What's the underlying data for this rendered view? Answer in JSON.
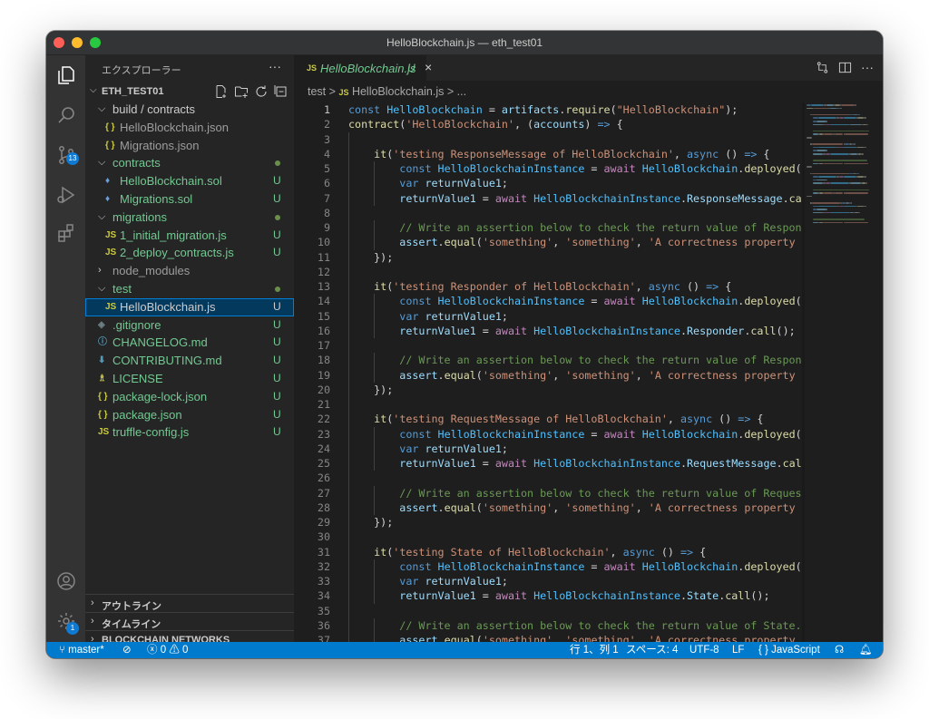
{
  "window": {
    "title": "HelloBlockchain.js — eth_test01"
  },
  "activity": {
    "scm_badge": "13",
    "manage_badge": "1"
  },
  "sidebar": {
    "header": "エクスプローラー",
    "more": "···",
    "workspace": "ETH_TEST01",
    "tree": [
      {
        "label": "build / contracts",
        "icon": "",
        "status": "",
        "level": 1,
        "type": "folder",
        "color": "white"
      },
      {
        "label": "HelloBlockchain.json",
        "icon": "{ }",
        "status": "",
        "level": 2,
        "type": "json",
        "color": "grey"
      },
      {
        "label": "Migrations.json",
        "icon": "{ }",
        "status": "",
        "level": 2,
        "type": "json",
        "color": "grey"
      },
      {
        "label": "contracts",
        "icon": "",
        "status": "",
        "level": 1,
        "type": "folder",
        "color": "green",
        "dot": true
      },
      {
        "label": "HelloBlockchain.sol",
        "icon": "♦",
        "status": "U",
        "level": 2,
        "type": "sol",
        "color": "green"
      },
      {
        "label": "Migrations.sol",
        "icon": "♦",
        "status": "U",
        "level": 2,
        "type": "sol",
        "color": "green"
      },
      {
        "label": "migrations",
        "icon": "",
        "status": "",
        "level": 1,
        "type": "folder",
        "color": "green",
        "dot": true
      },
      {
        "label": "1_initial_migration.js",
        "icon": "JS",
        "status": "U",
        "level": 2,
        "type": "js",
        "color": "green"
      },
      {
        "label": "2_deploy_contracts.js",
        "icon": "JS",
        "status": "U",
        "level": 2,
        "type": "js",
        "color": "green"
      },
      {
        "label": "node_modules",
        "icon": "",
        "status": "",
        "level": 1,
        "type": "folder-closed",
        "color": "grey"
      },
      {
        "label": "test",
        "icon": "",
        "status": "",
        "level": 1,
        "type": "folder",
        "color": "green",
        "dot": true
      },
      {
        "label": "HelloBlockchain.js",
        "icon": "JS",
        "status": "U",
        "level": 2,
        "type": "js",
        "color": "white",
        "selected": true
      },
      {
        "label": ".gitignore",
        "icon": "◈",
        "status": "U",
        "level": 1,
        "type": "git",
        "color": "green"
      },
      {
        "label": "CHANGELOG.md",
        "icon": "ⓘ",
        "status": "U",
        "level": 1,
        "type": "md",
        "color": "green"
      },
      {
        "label": "CONTRIBUTING.md",
        "icon": "⬇",
        "status": "U",
        "level": 1,
        "type": "md",
        "color": "green"
      },
      {
        "label": "LICENSE",
        "icon": "♗",
        "status": "U",
        "level": 1,
        "type": "license",
        "color": "green"
      },
      {
        "label": "package-lock.json",
        "icon": "{ }",
        "status": "U",
        "level": 1,
        "type": "json",
        "color": "green"
      },
      {
        "label": "package.json",
        "icon": "{ }",
        "status": "U",
        "level": 1,
        "type": "json",
        "color": "green"
      },
      {
        "label": "truffle-config.js",
        "icon": "JS",
        "status": "U",
        "level": 1,
        "type": "js",
        "color": "green"
      }
    ],
    "bottom": [
      "アウトライン",
      "タイムライン",
      "BLOCKCHAIN NETWORKS"
    ]
  },
  "editor": {
    "tab": {
      "icon": "JS",
      "name": "HelloBlockchain.js",
      "status": "U",
      "close": "×"
    },
    "breadcrumb": {
      "folder": "test",
      "sep": ">",
      "icon": "JS",
      "file": "HelloBlockchain.js",
      "tail": "> ..."
    },
    "lines": [
      [
        [
          "k",
          "const "
        ],
        [
          "cc",
          "HelloBlockchain"
        ],
        [
          "p",
          " = "
        ],
        [
          "v",
          "artifacts"
        ],
        [
          "p",
          "."
        ],
        [
          "f",
          "require"
        ],
        [
          "p",
          "("
        ],
        [
          "s",
          "\"HelloBlockchain\""
        ],
        [
          "p",
          ");"
        ]
      ],
      [
        [
          "f",
          "contract"
        ],
        [
          "p",
          "("
        ],
        [
          "s",
          "'HelloBlockchain'"
        ],
        [
          "p",
          ", ("
        ],
        [
          "v",
          "accounts"
        ],
        [
          "p",
          ") "
        ],
        [
          "k",
          "=>"
        ],
        [
          "p",
          " {"
        ]
      ],
      [],
      [
        [
          "p",
          "    "
        ],
        [
          "f",
          "it"
        ],
        [
          "p",
          "("
        ],
        [
          "s",
          "'testing ResponseMessage of HelloBlockchain'"
        ],
        [
          "p",
          ", "
        ],
        [
          "k",
          "async"
        ],
        [
          "p",
          " () "
        ],
        [
          "k",
          "=>"
        ],
        [
          "p",
          " {"
        ]
      ],
      [
        [
          "p",
          "        "
        ],
        [
          "k",
          "const "
        ],
        [
          "cc",
          "HelloBlockchainInstance"
        ],
        [
          "p",
          " = "
        ],
        [
          "kw",
          "await "
        ],
        [
          "cc",
          "HelloBlockchain"
        ],
        [
          "p",
          "."
        ],
        [
          "f",
          "deployed"
        ],
        [
          "p",
          "();"
        ]
      ],
      [
        [
          "p",
          "        "
        ],
        [
          "k",
          "var "
        ],
        [
          "v",
          "returnValue1"
        ],
        [
          "p",
          ";"
        ]
      ],
      [
        [
          "p",
          "        "
        ],
        [
          "v",
          "returnValue1"
        ],
        [
          "p",
          " = "
        ],
        [
          "kw",
          "await "
        ],
        [
          "cc",
          "HelloBlockchainInstance"
        ],
        [
          "p",
          "."
        ],
        [
          "v",
          "ResponseMessage"
        ],
        [
          "p",
          "."
        ],
        [
          "f",
          "call"
        ],
        [
          "p",
          "();"
        ]
      ],
      [],
      [
        [
          "p",
          "        "
        ],
        [
          "c",
          "// Write an assertion below to check the return value of ResponseMess"
        ]
      ],
      [
        [
          "p",
          "        "
        ],
        [
          "v",
          "assert"
        ],
        [
          "p",
          "."
        ],
        [
          "f",
          "equal"
        ],
        [
          "p",
          "("
        ],
        [
          "s",
          "'something'"
        ],
        [
          "p",
          ", "
        ],
        [
          "s",
          "'something'"
        ],
        [
          "p",
          ", "
        ],
        [
          "s",
          "'A correctness property about"
        ]
      ],
      [
        [
          "p",
          "    });"
        ]
      ],
      [],
      [
        [
          "p",
          "    "
        ],
        [
          "f",
          "it"
        ],
        [
          "p",
          "("
        ],
        [
          "s",
          "'testing Responder of HelloBlockchain'"
        ],
        [
          "p",
          ", "
        ],
        [
          "k",
          "async"
        ],
        [
          "p",
          " () "
        ],
        [
          "k",
          "=>"
        ],
        [
          "p",
          " {"
        ]
      ],
      [
        [
          "p",
          "        "
        ],
        [
          "k",
          "const "
        ],
        [
          "cc",
          "HelloBlockchainInstance"
        ],
        [
          "p",
          " = "
        ],
        [
          "kw",
          "await "
        ],
        [
          "cc",
          "HelloBlockchain"
        ],
        [
          "p",
          "."
        ],
        [
          "f",
          "deployed"
        ],
        [
          "p",
          "();"
        ]
      ],
      [
        [
          "p",
          "        "
        ],
        [
          "k",
          "var "
        ],
        [
          "v",
          "returnValue1"
        ],
        [
          "p",
          ";"
        ]
      ],
      [
        [
          "p",
          "        "
        ],
        [
          "v",
          "returnValue1"
        ],
        [
          "p",
          " = "
        ],
        [
          "kw",
          "await "
        ],
        [
          "cc",
          "HelloBlockchainInstance"
        ],
        [
          "p",
          "."
        ],
        [
          "v",
          "Responder"
        ],
        [
          "p",
          "."
        ],
        [
          "f",
          "call"
        ],
        [
          "p",
          "();"
        ]
      ],
      [],
      [
        [
          "p",
          "        "
        ],
        [
          "c",
          "// Write an assertion below to check the return value of Responder."
        ]
      ],
      [
        [
          "p",
          "        "
        ],
        [
          "v",
          "assert"
        ],
        [
          "p",
          "."
        ],
        [
          "f",
          "equal"
        ],
        [
          "p",
          "("
        ],
        [
          "s",
          "'something'"
        ],
        [
          "p",
          ", "
        ],
        [
          "s",
          "'something'"
        ],
        [
          "p",
          ", "
        ],
        [
          "s",
          "'A correctness property about"
        ]
      ],
      [
        [
          "p",
          "    });"
        ]
      ],
      [],
      [
        [
          "p",
          "    "
        ],
        [
          "f",
          "it"
        ],
        [
          "p",
          "("
        ],
        [
          "s",
          "'testing RequestMessage of HelloBlockchain'"
        ],
        [
          "p",
          ", "
        ],
        [
          "k",
          "async"
        ],
        [
          "p",
          " () "
        ],
        [
          "k",
          "=>"
        ],
        [
          "p",
          " {"
        ]
      ],
      [
        [
          "p",
          "        "
        ],
        [
          "k",
          "const "
        ],
        [
          "cc",
          "HelloBlockchainInstance"
        ],
        [
          "p",
          " = "
        ],
        [
          "kw",
          "await "
        ],
        [
          "cc",
          "HelloBlockchain"
        ],
        [
          "p",
          "."
        ],
        [
          "f",
          "deployed"
        ],
        [
          "p",
          "();"
        ]
      ],
      [
        [
          "p",
          "        "
        ],
        [
          "k",
          "var "
        ],
        [
          "v",
          "returnValue1"
        ],
        [
          "p",
          ";"
        ]
      ],
      [
        [
          "p",
          "        "
        ],
        [
          "v",
          "returnValue1"
        ],
        [
          "p",
          " = "
        ],
        [
          "kw",
          "await "
        ],
        [
          "cc",
          "HelloBlockchainInstance"
        ],
        [
          "p",
          "."
        ],
        [
          "v",
          "RequestMessage"
        ],
        [
          "p",
          "."
        ],
        [
          "f",
          "call"
        ],
        [
          "p",
          "();"
        ]
      ],
      [],
      [
        [
          "p",
          "        "
        ],
        [
          "c",
          "// Write an assertion below to check the return value of RequestMessa"
        ]
      ],
      [
        [
          "p",
          "        "
        ],
        [
          "v",
          "assert"
        ],
        [
          "p",
          "."
        ],
        [
          "f",
          "equal"
        ],
        [
          "p",
          "("
        ],
        [
          "s",
          "'something'"
        ],
        [
          "p",
          ", "
        ],
        [
          "s",
          "'something'"
        ],
        [
          "p",
          ", "
        ],
        [
          "s",
          "'A correctness property about"
        ]
      ],
      [
        [
          "p",
          "    });"
        ]
      ],
      [],
      [
        [
          "p",
          "    "
        ],
        [
          "f",
          "it"
        ],
        [
          "p",
          "("
        ],
        [
          "s",
          "'testing State of HelloBlockchain'"
        ],
        [
          "p",
          ", "
        ],
        [
          "k",
          "async"
        ],
        [
          "p",
          " () "
        ],
        [
          "k",
          "=>"
        ],
        [
          "p",
          " {"
        ]
      ],
      [
        [
          "p",
          "        "
        ],
        [
          "k",
          "const "
        ],
        [
          "cc",
          "HelloBlockchainInstance"
        ],
        [
          "p",
          " = "
        ],
        [
          "kw",
          "await "
        ],
        [
          "cc",
          "HelloBlockchain"
        ],
        [
          "p",
          "."
        ],
        [
          "f",
          "deployed"
        ],
        [
          "p",
          "();"
        ]
      ],
      [
        [
          "p",
          "        "
        ],
        [
          "k",
          "var "
        ],
        [
          "v",
          "returnValue1"
        ],
        [
          "p",
          ";"
        ]
      ],
      [
        [
          "p",
          "        "
        ],
        [
          "v",
          "returnValue1"
        ],
        [
          "p",
          " = "
        ],
        [
          "kw",
          "await "
        ],
        [
          "cc",
          "HelloBlockchainInstance"
        ],
        [
          "p",
          "."
        ],
        [
          "v",
          "State"
        ],
        [
          "p",
          "."
        ],
        [
          "f",
          "call"
        ],
        [
          "p",
          "();"
        ]
      ],
      [],
      [
        [
          "p",
          "        "
        ],
        [
          "c",
          "// Write an assertion below to check the return value of State."
        ]
      ],
      [
        [
          "p",
          "        "
        ],
        [
          "v",
          "assert"
        ],
        [
          "p",
          "."
        ],
        [
          "f",
          "equal"
        ],
        [
          "p",
          "("
        ],
        [
          "s",
          "'something'"
        ],
        [
          "p",
          ", "
        ],
        [
          "s",
          "'something'"
        ],
        [
          "p",
          ", "
        ],
        [
          "s",
          "'A correctness property about"
        ]
      ]
    ]
  },
  "status": {
    "branch": "master*",
    "errors": "0",
    "warnings": "0",
    "position": "行 1、列 1",
    "spaces": "スペース: 4",
    "encoding": "UTF-8",
    "eol": "LF",
    "language": "{ } JavaScript"
  },
  "colors": {
    "statusbar": "#007acc",
    "untracked": "#73c991",
    "accent": "#0e7ad3"
  }
}
